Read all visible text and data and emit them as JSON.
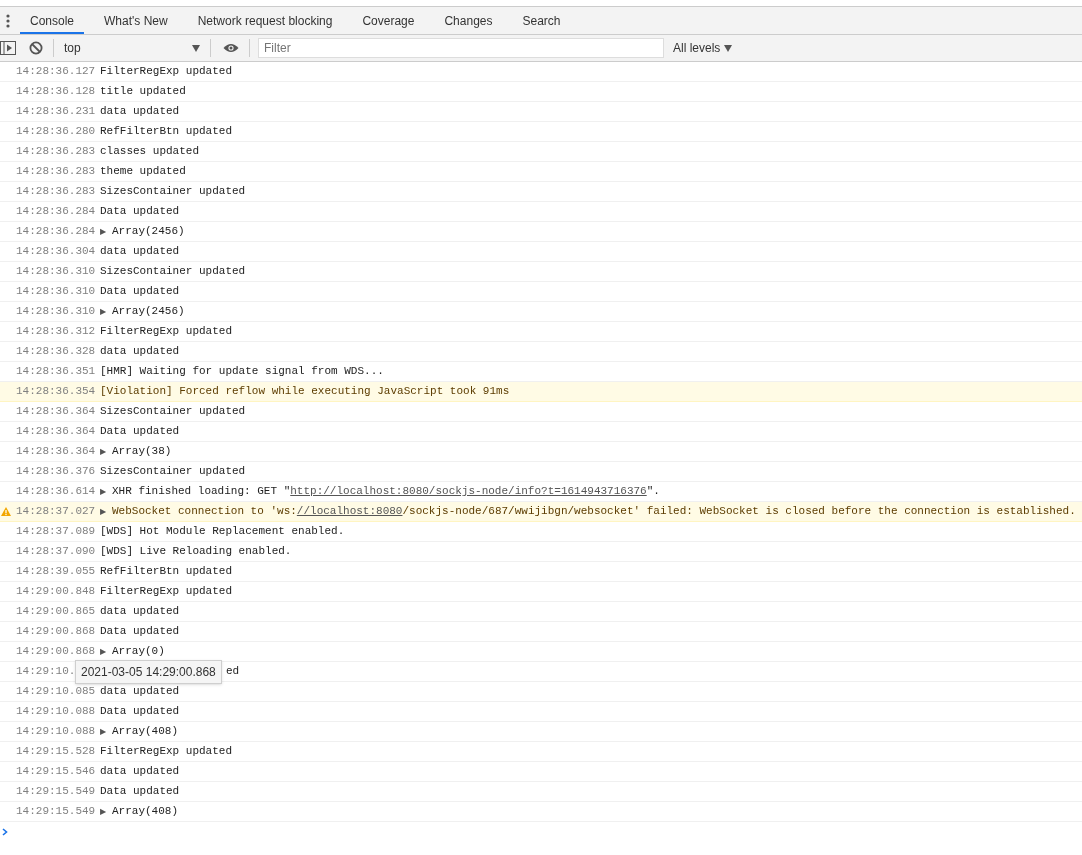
{
  "tabs": [
    {
      "label": "Console",
      "selected": true
    },
    {
      "label": "What's New",
      "selected": false
    },
    {
      "label": "Network request blocking",
      "selected": false
    },
    {
      "label": "Coverage",
      "selected": false
    },
    {
      "label": "Changes",
      "selected": false
    },
    {
      "label": "Search",
      "selected": false
    }
  ],
  "toolbar": {
    "context": "top",
    "filter": {
      "placeholder": "Filter"
    },
    "levels": "All levels"
  },
  "rows": [
    {
      "kind": "log",
      "time": "14:28:36.127",
      "message": "FilterRegExp updated"
    },
    {
      "kind": "log",
      "time": "14:28:36.128",
      "message": "title updated"
    },
    {
      "kind": "log",
      "time": "14:28:36.231",
      "message": "data updated"
    },
    {
      "kind": "log",
      "time": "14:28:36.280",
      "message": "RefFilterBtn updated"
    },
    {
      "kind": "log",
      "time": "14:28:36.283",
      "message": "classes updated"
    },
    {
      "kind": "log",
      "time": "14:28:36.283",
      "message": "theme updated"
    },
    {
      "kind": "log",
      "time": "14:28:36.283",
      "message": "SizesContainer updated"
    },
    {
      "kind": "log",
      "time": "14:28:36.284",
      "message": "Data updated"
    },
    {
      "kind": "log",
      "time": "14:28:36.284",
      "toggle": "▶",
      "message": "Array(2456)"
    },
    {
      "kind": "log",
      "time": "14:28:36.304",
      "message": "data updated"
    },
    {
      "kind": "log",
      "time": "14:28:36.310",
      "message": "SizesContainer updated"
    },
    {
      "kind": "log",
      "time": "14:28:36.310",
      "message": "Data updated"
    },
    {
      "kind": "log",
      "time": "14:28:36.310",
      "toggle": "▶",
      "message": "Array(2456)"
    },
    {
      "kind": "log",
      "time": "14:28:36.312",
      "message": "FilterRegExp updated"
    },
    {
      "kind": "log",
      "time": "14:28:36.328",
      "message": "data updated"
    },
    {
      "kind": "log",
      "time": "14:28:36.351",
      "message": "[HMR] Waiting for update signal from WDS..."
    },
    {
      "kind": "violation",
      "time": "14:28:36.354",
      "message": "[Violation] Forced reflow while executing JavaScript took 91ms"
    },
    {
      "kind": "log",
      "time": "14:28:36.364",
      "message": "SizesContainer updated"
    },
    {
      "kind": "log",
      "time": "14:28:36.364",
      "message": "Data updated"
    },
    {
      "kind": "log",
      "time": "14:28:36.364",
      "toggle": "▶",
      "message": "Array(38)"
    },
    {
      "kind": "log",
      "time": "14:28:36.376",
      "message": "SizesContainer updated"
    },
    {
      "kind": "log",
      "time": "14:28:36.614",
      "toggle": "▶",
      "parts": [
        {
          "text": "XHR finished loading: GET \"",
          "link": false
        },
        {
          "text": "http://localhost:8080/sockjs-node/info?t=1614943716376",
          "link": true
        },
        {
          "text": "\".",
          "link": false
        }
      ]
    },
    {
      "kind": "warning",
      "time": "14:28:37.027",
      "toggle": "▶",
      "parts": [
        {
          "text": "WebSocket connection to 'ws:",
          "link": false
        },
        {
          "text": "//localhost:8080",
          "link": true
        },
        {
          "text": "/sockjs-node/687/wwijibgn/websocket' failed: WebSocket is closed before the connection is established.",
          "link": false
        }
      ]
    },
    {
      "kind": "log",
      "time": "14:28:37.089",
      "message": "[WDS] Hot Module Replacement enabled."
    },
    {
      "kind": "log",
      "time": "14:28:37.090",
      "message": "[WDS] Live Reloading enabled."
    },
    {
      "kind": "log",
      "time": "14:28:39.055",
      "message": "RefFilterBtn updated"
    },
    {
      "kind": "log",
      "time": "14:29:00.848",
      "message": "FilterRegExp updated"
    },
    {
      "kind": "log",
      "time": "14:29:00.865",
      "message": "data updated"
    },
    {
      "kind": "log",
      "time": "14:29:00.868",
      "message": "Data updated"
    },
    {
      "kind": "log",
      "time": "14:29:00.868",
      "toggle": "▶",
      "message": "Array(0)"
    },
    {
      "kind": "covered",
      "time": "14:29:10.",
      "message": "ed",
      "tooltip": "2021-03-05 14:29:00.868"
    },
    {
      "kind": "log",
      "time": "14:29:10.085",
      "message": "data updated"
    },
    {
      "kind": "log",
      "time": "14:29:10.088",
      "message": "Data updated"
    },
    {
      "kind": "log",
      "time": "14:29:10.088",
      "toggle": "▶",
      "message": "Array(408)"
    },
    {
      "kind": "log",
      "time": "14:29:15.528",
      "message": "FilterRegExp updated"
    },
    {
      "kind": "log",
      "time": "14:29:15.546",
      "message": "data updated"
    },
    {
      "kind": "log",
      "time": "14:29:15.549",
      "message": "Data updated"
    },
    {
      "kind": "log",
      "time": "14:29:15.549",
      "toggle": "▶",
      "message": "Array(408)"
    }
  ]
}
